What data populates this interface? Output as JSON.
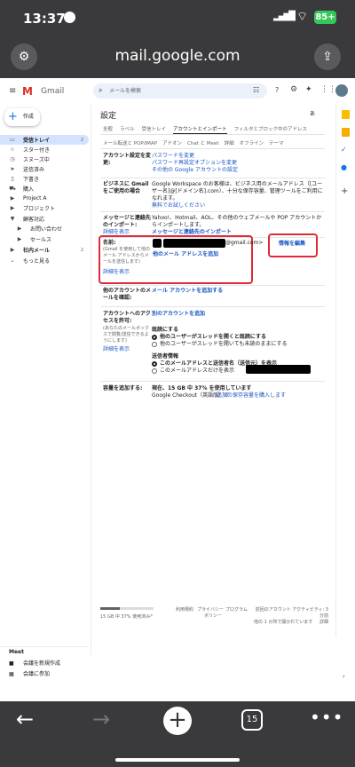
{
  "status": {
    "time": "13:37",
    "signal": "▂▄▆█",
    "battery": "85+"
  },
  "browser": {
    "url": "mail.google.com",
    "tab_count": "15"
  },
  "gmail": {
    "app_name": "Gmail",
    "search_placeholder": "メールを検索",
    "compose": "作成",
    "nav": [
      {
        "label": "受信トレイ",
        "count": "2",
        "icon": "▭",
        "bold": true
      },
      {
        "label": "スター付き",
        "count": "",
        "icon": "☆"
      },
      {
        "label": "スヌーズ中",
        "count": "",
        "icon": "◷"
      },
      {
        "label": "送信済み",
        "count": "",
        "icon": "➤"
      },
      {
        "label": "下書き",
        "count": "",
        "icon": "▯"
      },
      {
        "label": "購入",
        "count": "",
        "icon": "⛟"
      },
      {
        "label": "Project A",
        "count": "",
        "icon": "▶"
      },
      {
        "label": "プロジェクト",
        "count": "",
        "icon": "▶"
      },
      {
        "label": "顧客対応",
        "count": "",
        "icon": "▼"
      },
      {
        "label": "お問い合わせ",
        "count": "",
        "icon": "▶"
      },
      {
        "label": "セールス",
        "count": "",
        "icon": "▶"
      },
      {
        "label": "社内メール",
        "count": "2",
        "icon": "▶",
        "bold": true
      },
      {
        "label": "もっと見る",
        "count": "",
        "icon": "⌄"
      }
    ],
    "settings_title": "設定",
    "lang_btn": "あ",
    "tabs1": [
      "全般",
      "ラベル",
      "受信トレイ",
      "アカウントとインポート",
      "フィルタとブロック中のアドレス"
    ],
    "tabs2": [
      "メール転送と POP/IMAP",
      "アドオン",
      "Chat と Meet",
      "詳細",
      "オフライン",
      "テーマ"
    ],
    "s1": {
      "label": "アカウント設定を変更:",
      "links": [
        "パスワードを変更",
        "パスワード再設定オプションを変更",
        "その他の Google アカウントの設定"
      ]
    },
    "s2": {
      "label": "ビジネスに Gmail をご使用の場合",
      "text": "Google Workspace のお客様は、ビジネス用のメールアドレス（[ユーザー名]@[ドメイン名].com）、十分な保存容量、管理ツールをご利用になれます。",
      "link": "無料でお試しください"
    },
    "s3": {
      "label": "メッセージと連絡先のインポート:",
      "text": "Yahoo!、Hotmail、AOL、その他のウェブメールや POP アカウントからインポートします。",
      "link": "メッセージと連絡先のインポート",
      "detail": "詳細を表示"
    },
    "s4": {
      "label": "名前:",
      "note": "(Gmail を使用して他のメール アドレスからメールを送信します)",
      "detail": "詳細を表示",
      "email_suffix": "@gmail.com>",
      "add_link": "他のメール アドレスを追加",
      "edit": "情報を編集"
    },
    "s5": {
      "label": "他のアカウントのメールを確認:",
      "link": "メール アカウントを追加する"
    },
    "s6": {
      "label": "アカウントへのアクセスを許可:",
      "note": "(あなたのメールボックスで閲覧/送信できるようにします)",
      "detail": "詳細を表示",
      "link": "別のアカウントを追加",
      "read_title": "既読にする",
      "read_opts": [
        "他のユーザーがスレッドを開くと既読にする",
        "他のユーザーがスレッドを開いても未読のままにする"
      ],
      "sender_title": "送信者情報",
      "sender_opts": [
        "このメールアドレスと送信者名（送信元）を表示",
        "このメールアドレスだけを表示"
      ]
    },
    "s7": {
      "label": "容量を追加する:",
      "text": "現在、15 GB 中 37% を使用しています",
      "text2": "Google Checkout（英語版）で",
      "link": "追加の保存容量を購入します"
    },
    "footer": {
      "usage": "15 GB 中 37% 使用済み",
      "terms": "利用規約",
      "privacy": "プライバシー",
      "policy": "ポリシー",
      "program": "プログラム",
      "activity": "前回のアカウント アクティビティ: 3 分前",
      "other": "他の 1 か所で開かれています",
      "detail": "詳細"
    },
    "meet": {
      "title": "Meet",
      "new": "会議を新規作成",
      "join": "会議に参加"
    }
  }
}
